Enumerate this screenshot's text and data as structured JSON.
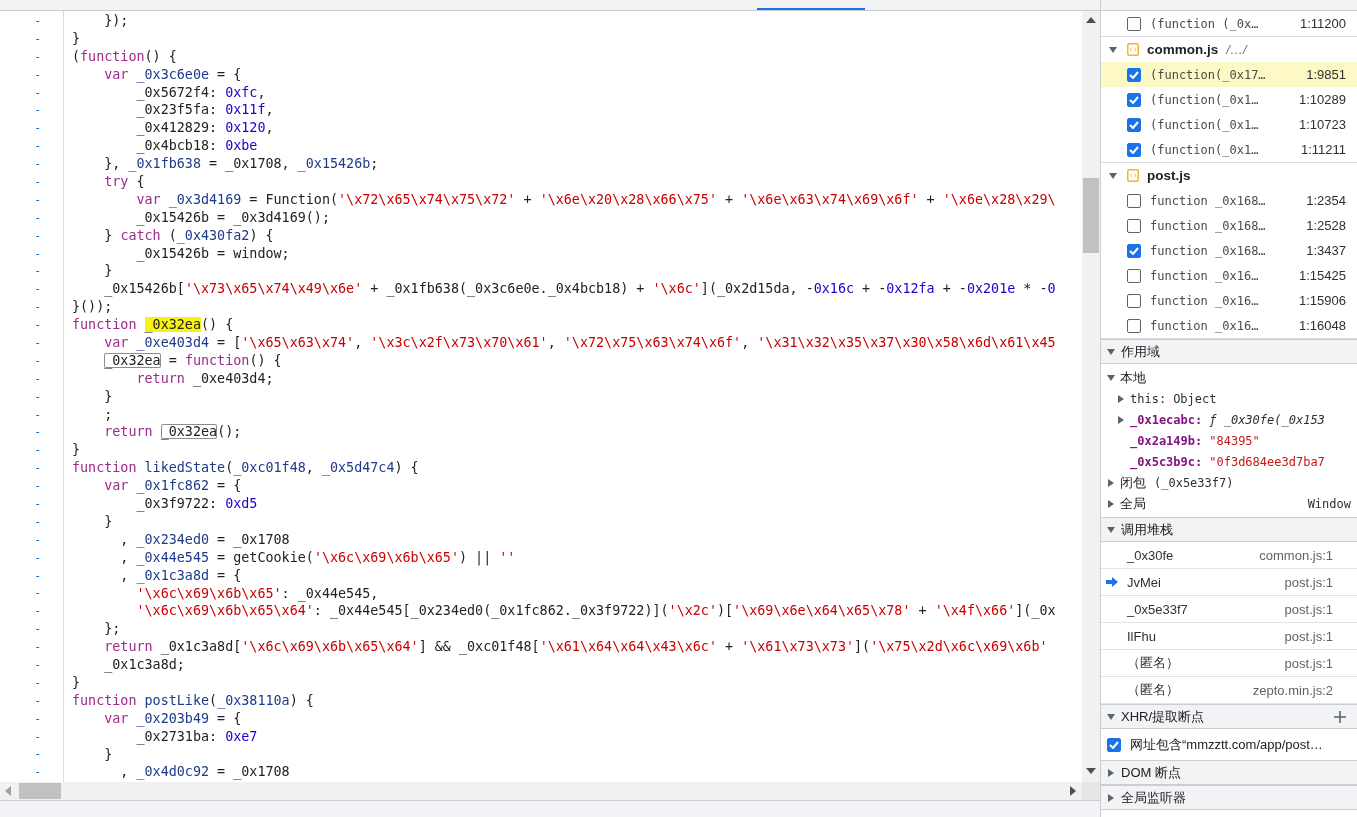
{
  "editor": {
    "lines": [
      {
        "marker": "-",
        "segments": [
          {
            "kind": "plain",
            "text": "    });"
          }
        ]
      },
      {
        "marker": "-",
        "segments": [
          {
            "kind": "plain",
            "text": "}"
          }
        ]
      },
      {
        "marker": "-",
        "segments": [
          {
            "kind": "plain",
            "text": "("
          },
          {
            "kind": "keyword",
            "text": "function"
          },
          {
            "kind": "plain",
            "text": "() {"
          }
        ]
      },
      {
        "marker": "-",
        "segments": [
          {
            "kind": "keyword",
            "text": "    var"
          },
          {
            "kind": "name",
            "text": " _0x3c6e0e"
          },
          {
            "kind": "plain",
            "text": " = {"
          }
        ]
      },
      {
        "marker": "-",
        "segments": [
          {
            "kind": "plain",
            "text": "        _0x5672f4: "
          },
          {
            "kind": "number",
            "text": "0xfc"
          },
          {
            "kind": "plain",
            "text": ","
          }
        ]
      },
      {
        "marker": "-",
        "segments": [
          {
            "kind": "plain",
            "text": "        _0x23f5fa: "
          },
          {
            "kind": "number",
            "text": "0x11f"
          },
          {
            "kind": "plain",
            "text": ","
          }
        ]
      },
      {
        "marker": "-",
        "segments": [
          {
            "kind": "plain",
            "text": "        _0x412829: "
          },
          {
            "kind": "number",
            "text": "0x120"
          },
          {
            "kind": "plain",
            "text": ","
          }
        ]
      },
      {
        "marker": "-",
        "segments": [
          {
            "kind": "plain",
            "text": "        _0x4bcb18: "
          },
          {
            "kind": "number",
            "text": "0xbe"
          }
        ]
      },
      {
        "marker": "-",
        "segments": [
          {
            "kind": "plain",
            "text": "    }, "
          },
          {
            "kind": "name",
            "text": "_0x1fb638"
          },
          {
            "kind": "plain",
            "text": " = _0x1708, "
          },
          {
            "kind": "name",
            "text": "_0x15426b"
          },
          {
            "kind": "plain",
            "text": ";"
          }
        ]
      },
      {
        "marker": "-",
        "segments": [
          {
            "kind": "keyword",
            "text": "    try"
          },
          {
            "kind": "plain",
            "text": " {"
          }
        ]
      },
      {
        "marker": "-",
        "segments": [
          {
            "kind": "keyword",
            "text": "        var"
          },
          {
            "kind": "name",
            "text": " _0x3d4169"
          },
          {
            "kind": "plain",
            "text": " = Function("
          },
          {
            "kind": "string",
            "text": "'\\x72\\x65\\x74\\x75\\x72'"
          },
          {
            "kind": "plain",
            "text": " + "
          },
          {
            "kind": "string",
            "text": "'\\x6e\\x20\\x28\\x66\\x75'"
          },
          {
            "kind": "plain",
            "text": " + "
          },
          {
            "kind": "string",
            "text": "'\\x6e\\x63\\x74\\x69\\x6f'"
          },
          {
            "kind": "plain",
            "text": " + "
          },
          {
            "kind": "string",
            "text": "'\\x6e\\x28\\x29\\"
          }
        ]
      },
      {
        "marker": "-",
        "segments": [
          {
            "kind": "plain",
            "text": "        _0x15426b = _0x3d4169();"
          }
        ]
      },
      {
        "marker": "-",
        "segments": [
          {
            "kind": "plain",
            "text": "    } "
          },
          {
            "kind": "keyword",
            "text": "catch"
          },
          {
            "kind": "plain",
            "text": " ("
          },
          {
            "kind": "name",
            "text": "_0x430fa2"
          },
          {
            "kind": "plain",
            "text": ") {"
          }
        ]
      },
      {
        "marker": "-",
        "segments": [
          {
            "kind": "plain",
            "text": "        _0x15426b = window;"
          }
        ]
      },
      {
        "marker": "-",
        "segments": [
          {
            "kind": "plain",
            "text": "    }"
          }
        ]
      },
      {
        "marker": "-",
        "segments": [
          {
            "kind": "plain",
            "text": "    _0x15426b["
          },
          {
            "kind": "string",
            "text": "'\\x73\\x65\\x74\\x49\\x6e'"
          },
          {
            "kind": "plain",
            "text": " + _0x1fb638(_0x3c6e0e._0x4bcb18) + "
          },
          {
            "kind": "string",
            "text": "'\\x6c'"
          },
          {
            "kind": "plain",
            "text": "](_0x2d15da, -"
          },
          {
            "kind": "number",
            "text": "0x16c"
          },
          {
            "kind": "plain",
            "text": " + -"
          },
          {
            "kind": "number",
            "text": "0x12fa"
          },
          {
            "kind": "plain",
            "text": " + -"
          },
          {
            "kind": "number",
            "text": "0x201e"
          },
          {
            "kind": "plain",
            "text": " * -"
          },
          {
            "kind": "number",
            "text": "0"
          }
        ]
      },
      {
        "marker": "-",
        "segments": [
          {
            "kind": "plain",
            "text": "}());"
          }
        ]
      },
      {
        "marker": "-",
        "segments": [
          {
            "kind": "keyword",
            "text": "function "
          },
          {
            "kind": "match",
            "text": "_0x32ea"
          },
          {
            "kind": "plain",
            "text": "() {"
          }
        ]
      },
      {
        "marker": "-",
        "segments": [
          {
            "kind": "keyword",
            "text": "    var"
          },
          {
            "kind": "name",
            "text": " _0xe403d4"
          },
          {
            "kind": "plain",
            "text": " = ["
          },
          {
            "kind": "string",
            "text": "'\\x65\\x63\\x74'"
          },
          {
            "kind": "plain",
            "text": ", "
          },
          {
            "kind": "string",
            "text": "'\\x3c\\x2f\\x73\\x70\\x61'"
          },
          {
            "kind": "plain",
            "text": ", "
          },
          {
            "kind": "string",
            "text": "'\\x72\\x75\\x63\\x74\\x6f'"
          },
          {
            "kind": "plain",
            "text": ", "
          },
          {
            "kind": "string",
            "text": "'\\x31\\x32\\x35\\x37\\x30\\x58\\x6d\\x61\\x45"
          }
        ]
      },
      {
        "marker": "-",
        "segments": [
          {
            "kind": "reference",
            "text": "    _0x32ea"
          },
          {
            "kind": "plain",
            "text": " = "
          },
          {
            "kind": "keyword",
            "text": "function"
          },
          {
            "kind": "plain",
            "text": "() {"
          }
        ]
      },
      {
        "marker": "-",
        "segments": [
          {
            "kind": "keyword",
            "text": "        return"
          },
          {
            "kind": "plain",
            "text": " _0xe403d4;"
          }
        ]
      },
      {
        "marker": "-",
        "segments": [
          {
            "kind": "plain",
            "text": "    }"
          }
        ]
      },
      {
        "marker": "-",
        "segments": [
          {
            "kind": "plain",
            "text": "    ;"
          }
        ]
      },
      {
        "marker": "-",
        "segments": [
          {
            "kind": "keyword",
            "text": "    return "
          },
          {
            "kind": "reference",
            "text": "_0x32ea"
          },
          {
            "kind": "plain",
            "text": "();"
          }
        ]
      },
      {
        "marker": "-",
        "segments": [
          {
            "kind": "plain",
            "text": "}"
          }
        ]
      },
      {
        "marker": "-",
        "segments": [
          {
            "kind": "keyword",
            "text": "function"
          },
          {
            "kind": "name",
            "text": " likedState"
          },
          {
            "kind": "plain",
            "text": "("
          },
          {
            "kind": "name",
            "text": "_0xc01f48"
          },
          {
            "kind": "plain",
            "text": ", "
          },
          {
            "kind": "name",
            "text": "_0x5d47c4"
          },
          {
            "kind": "plain",
            "text": ") {"
          }
        ]
      },
      {
        "marker": "-",
        "segments": [
          {
            "kind": "keyword",
            "text": "    var"
          },
          {
            "kind": "name",
            "text": " _0x1fc862"
          },
          {
            "kind": "plain",
            "text": " = {"
          }
        ]
      },
      {
        "marker": "-",
        "segments": [
          {
            "kind": "plain",
            "text": "        _0x3f9722: "
          },
          {
            "kind": "number",
            "text": "0xd5"
          }
        ]
      },
      {
        "marker": "-",
        "segments": [
          {
            "kind": "plain",
            "text": "    }"
          }
        ]
      },
      {
        "marker": "-",
        "segments": [
          {
            "kind": "plain",
            "text": "      , "
          },
          {
            "kind": "name",
            "text": "_0x234ed0"
          },
          {
            "kind": "plain",
            "text": " = _0x1708"
          }
        ]
      },
      {
        "marker": "-",
        "segments": [
          {
            "kind": "plain",
            "text": "      , "
          },
          {
            "kind": "name",
            "text": "_0x44e545"
          },
          {
            "kind": "plain",
            "text": " = getCookie("
          },
          {
            "kind": "string",
            "text": "'\\x6c\\x69\\x6b\\x65'"
          },
          {
            "kind": "plain",
            "text": ") || "
          },
          {
            "kind": "string",
            "text": "''"
          }
        ]
      },
      {
        "marker": "-",
        "segments": [
          {
            "kind": "plain",
            "text": "      , "
          },
          {
            "kind": "name",
            "text": "_0x1c3a8d"
          },
          {
            "kind": "plain",
            "text": " = {"
          }
        ]
      },
      {
        "marker": "-",
        "segments": [
          {
            "kind": "string",
            "text": "        '\\x6c\\x69\\x6b\\x65'"
          },
          {
            "kind": "plain",
            "text": ": _0x44e545,"
          }
        ]
      },
      {
        "marker": "-",
        "segments": [
          {
            "kind": "string",
            "text": "        '\\x6c\\x69\\x6b\\x65\\x64'"
          },
          {
            "kind": "plain",
            "text": ": _0x44e545[_0x234ed0(_0x1fc862._0x3f9722)]("
          },
          {
            "kind": "string",
            "text": "'\\x2c'"
          },
          {
            "kind": "plain",
            "text": ")["
          },
          {
            "kind": "string",
            "text": "'\\x69\\x6e\\x64\\x65\\x78'"
          },
          {
            "kind": "plain",
            "text": " + "
          },
          {
            "kind": "string",
            "text": "'\\x4f\\x66'"
          },
          {
            "kind": "plain",
            "text": "](_0x"
          }
        ]
      },
      {
        "marker": "-",
        "segments": [
          {
            "kind": "plain",
            "text": "    };"
          }
        ]
      },
      {
        "marker": "-",
        "segments": [
          {
            "kind": "keyword",
            "text": "    return"
          },
          {
            "kind": "plain",
            "text": " _0x1c3a8d["
          },
          {
            "kind": "string",
            "text": "'\\x6c\\x69\\x6b\\x65\\x64'"
          },
          {
            "kind": "plain",
            "text": "] && _0xc01f48["
          },
          {
            "kind": "string",
            "text": "'\\x61\\x64\\x64\\x43\\x6c'"
          },
          {
            "kind": "plain",
            "text": " + "
          },
          {
            "kind": "string",
            "text": "'\\x61\\x73\\x73'"
          },
          {
            "kind": "plain",
            "text": "]("
          },
          {
            "kind": "string",
            "text": "'\\x75\\x2d\\x6c\\x69\\x6b'"
          }
        ]
      },
      {
        "marker": "-",
        "segments": [
          {
            "kind": "plain",
            "text": "    _0x1c3a8d;"
          }
        ]
      },
      {
        "marker": "-",
        "segments": [
          {
            "kind": "plain",
            "text": "}"
          }
        ]
      },
      {
        "marker": "-",
        "segments": [
          {
            "kind": "keyword",
            "text": "function"
          },
          {
            "kind": "name",
            "text": " postLike"
          },
          {
            "kind": "plain",
            "text": "("
          },
          {
            "kind": "name",
            "text": "_0x38110a"
          },
          {
            "kind": "plain",
            "text": ") {"
          }
        ]
      },
      {
        "marker": "-",
        "segments": [
          {
            "kind": "keyword",
            "text": "    var"
          },
          {
            "kind": "name",
            "text": " _0x203b49"
          },
          {
            "kind": "plain",
            "text": " = {"
          }
        ]
      },
      {
        "marker": "-",
        "segments": [
          {
            "kind": "plain",
            "text": "        _0x2731ba: "
          },
          {
            "kind": "number",
            "text": "0xe7"
          }
        ]
      },
      {
        "marker": "-",
        "segments": [
          {
            "kind": "plain",
            "text": "    }"
          }
        ]
      },
      {
        "marker": "-",
        "segments": [
          {
            "kind": "plain",
            "text": "      , "
          },
          {
            "kind": "name",
            "text": "_0x4d0c92"
          },
          {
            "kind": "plain",
            "text": " = _0x1708"
          }
        ]
      }
    ]
  },
  "sidebar": {
    "breakpoint_groups": [
      {
        "items": [
          {
            "label": "(function (_0x…",
            "location": "1:11200",
            "checked": false,
            "paused": false
          }
        ]
      },
      {
        "file": "common.js",
        "path": "/…/",
        "expanded": true,
        "items": [
          {
            "label": "(function(_0x17…",
            "location": "1:9851",
            "checked": true,
            "paused": true
          },
          {
            "label": "(function(_0x1…",
            "location": "1:10289",
            "checked": true,
            "paused": false
          },
          {
            "label": "(function(_0x1…",
            "location": "1:10723",
            "checked": true,
            "paused": false
          },
          {
            "label": "(function(_0x1…",
            "location": "1:11211",
            "checked": true,
            "paused": false
          }
        ]
      },
      {
        "file": "post.js",
        "expanded": true,
        "items": [
          {
            "label": "function _0x168…",
            "location": "1:2354",
            "checked": false,
            "paused": false
          },
          {
            "label": "function _0x168…",
            "location": "1:2528",
            "checked": false,
            "paused": false
          },
          {
            "label": "function _0x168…",
            "location": "1:3437",
            "checked": true,
            "paused": false
          },
          {
            "label": "function _0x16…",
            "location": "1:15425",
            "checked": false,
            "paused": false
          },
          {
            "label": "function _0x16…",
            "location": "1:15906",
            "checked": false,
            "paused": false
          },
          {
            "label": "function _0x16…",
            "location": "1:16048",
            "checked": false,
            "paused": false
          }
        ]
      }
    ],
    "scope": {
      "title": "作用域",
      "expanded": true,
      "tree": [
        {
          "label": "本地",
          "expanded": true,
          "children": [
            {
              "name": "this:",
              "kind": "receiver",
              "value": "Object",
              "expanded": false
            },
            {
              "name": "_0x1ecabc:",
              "kind": "function",
              "value": "ƒ _0x30fe(_0x153",
              "expanded": false
            },
            {
              "name": "_0x2a149b:",
              "kind": "string",
              "value": "\"84395\""
            },
            {
              "name": "_0x5c3b9c:",
              "kind": "string",
              "value": "\"0f3d684ee3d7ba7"
            }
          ]
        },
        {
          "label": "闭包",
          "detail": "(_0x5e33f7)",
          "expanded": false
        },
        {
          "label": "全局",
          "value": "Window",
          "expanded": false
        }
      ]
    },
    "call_stack": {
      "title": "调用堆栈",
      "expanded": true,
      "frames": [
        {
          "function": "_0x30fe",
          "location": "common.js:1",
          "selected": false
        },
        {
          "function": "JvMei",
          "location": "post.js:1",
          "selected": true
        },
        {
          "function": "_0x5e33f7",
          "location": "post.js:1",
          "selected": false
        },
        {
          "function": "IlFhu",
          "location": "post.js:1",
          "selected": false
        },
        {
          "function": "（匿名）",
          "location": "post.js:1",
          "selected": false
        },
        {
          "function": "（匿名）",
          "location": "zepto.min.js:2",
          "selected": false
        }
      ]
    },
    "xhr_breakpoints": {
      "title": "XHR/提取断点",
      "expanded": true,
      "items": [
        {
          "label": "网址包含“mmzztt.com/app/post…",
          "checked": true
        }
      ]
    },
    "dom_breakpoints": {
      "title": "DOM 断点",
      "expanded": false
    },
    "global_listeners": {
      "title": "全局监听器",
      "expanded": false
    }
  }
}
